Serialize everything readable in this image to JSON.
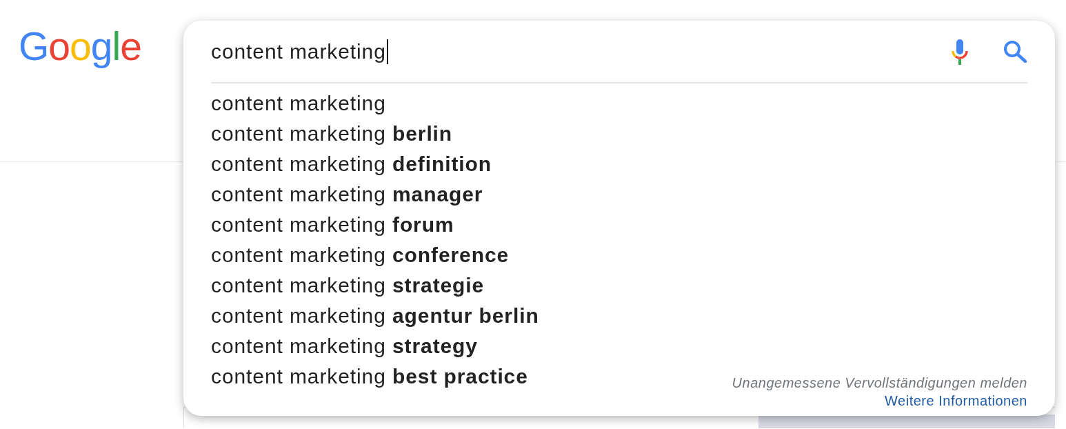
{
  "logo": {
    "text": "Google"
  },
  "search": {
    "value": "content marketing",
    "focused": true
  },
  "suggestions": [
    {
      "text": "content marketing",
      "selected": false
    },
    {
      "text": "content marketing **berlin**",
      "selected": false
    },
    {
      "text": "content marketing **definition**",
      "selected": false
    },
    {
      "text": "content marketing **manager**",
      "selected": false
    },
    {
      "text": "content marketing **forum**",
      "selected": false
    },
    {
      "text": "content marketing **conference**",
      "selected": false
    },
    {
      "text": "content marketing **strategie**",
      "selected": false
    },
    {
      "text": "content marketing **agentur berlin**",
      "selected": false
    },
    {
      "text": "content marketing **strategy**",
      "selected": false
    },
    {
      "text": "content marketing **best practice**",
      "selected": false
    }
  ],
  "footer": {
    "report_link": "Unangemessene Vervollständigungen melden",
    "info_link": "Weitere Informationen"
  }
}
